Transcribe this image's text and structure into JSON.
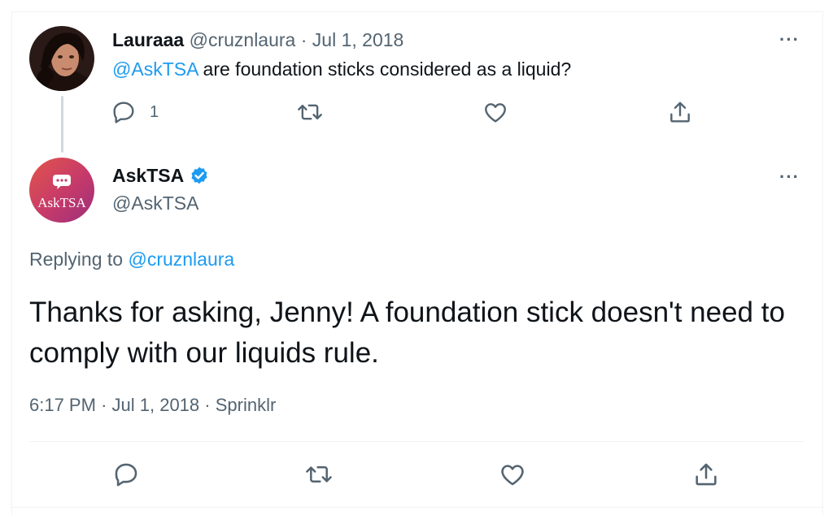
{
  "parent_tweet": {
    "display_name": "Lauraaa",
    "handle": "@cruznlaura",
    "separator": "·",
    "date": "Jul 1, 2018",
    "mention": "@AskTSA",
    "text": " are foundation sticks considered as a liquid?",
    "reply_count": "1",
    "more_icon": "more-dots-icon"
  },
  "main_tweet": {
    "display_name": "AskTSA",
    "handle": "@AskTSA",
    "avatar_text": "AskTSA",
    "verified_icon": "verified-badge-icon",
    "replying_prefix": "Replying to ",
    "replying_handle": "@cruznlaura",
    "text": "Thanks for asking, Jenny! A foundation stick doesn't need to comply with our liquids rule.",
    "time": "6:17 PM",
    "date": "Jul 1, 2018",
    "source": "Sprinklr",
    "sep": "·"
  },
  "actions": [
    "reply-icon",
    "retweet-icon",
    "like-icon",
    "share-icon"
  ],
  "colors": {
    "text": "#0f1419",
    "muted": "#536471",
    "link": "#1d9bf0",
    "verified": "#1d9bf0",
    "divider": "#eff3f4",
    "thread_line": "#cfd9de"
  }
}
